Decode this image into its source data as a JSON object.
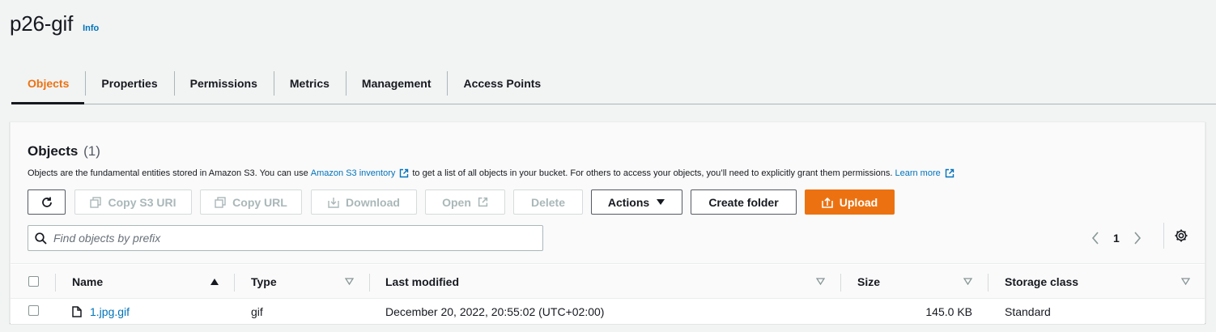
{
  "header": {
    "bucket_name": "p26-gif",
    "info_label": "Info"
  },
  "tabs": [
    {
      "label": "Objects",
      "active": true
    },
    {
      "label": "Properties"
    },
    {
      "label": "Permissions"
    },
    {
      "label": "Metrics"
    },
    {
      "label": "Management"
    },
    {
      "label": "Access Points"
    }
  ],
  "objects_panel": {
    "title": "Objects",
    "count": "(1)",
    "description": {
      "part1": "Objects are the fundamental entities stored in Amazon S3. You can use",
      "inventory_link": "Amazon S3 inventory",
      "part2": "to get a list of all objects in your bucket. For others to access your objects, you’ll need to explicitly grant them permissions.",
      "learn_more": "Learn more"
    },
    "toolbar": {
      "copy_s3_uri": "Copy S3 URI",
      "copy_url": "Copy URL",
      "download": "Download",
      "open": "Open",
      "delete": "Delete",
      "actions": "Actions",
      "create_folder": "Create folder",
      "upload": "Upload"
    },
    "search": {
      "placeholder": "Find objects by prefix",
      "value": ""
    },
    "pagination": {
      "current_page": "1"
    },
    "table": {
      "columns": [
        "Name",
        "Type",
        "Last modified",
        "Size",
        "Storage class"
      ],
      "rows": [
        {
          "name": "1.jpg.gif",
          "type": "gif",
          "last_modified": "December 20, 2022, 20:55:02 (UTC+02:00)",
          "size": "145.0 KB",
          "storage_class": "Standard"
        }
      ]
    }
  },
  "colors": {
    "accent_orange": "#ec7211",
    "link_blue": "#0073bb",
    "text_dark": "#16191f",
    "disabled_gray": "#aab7b8",
    "background": "#f2f3f3"
  }
}
